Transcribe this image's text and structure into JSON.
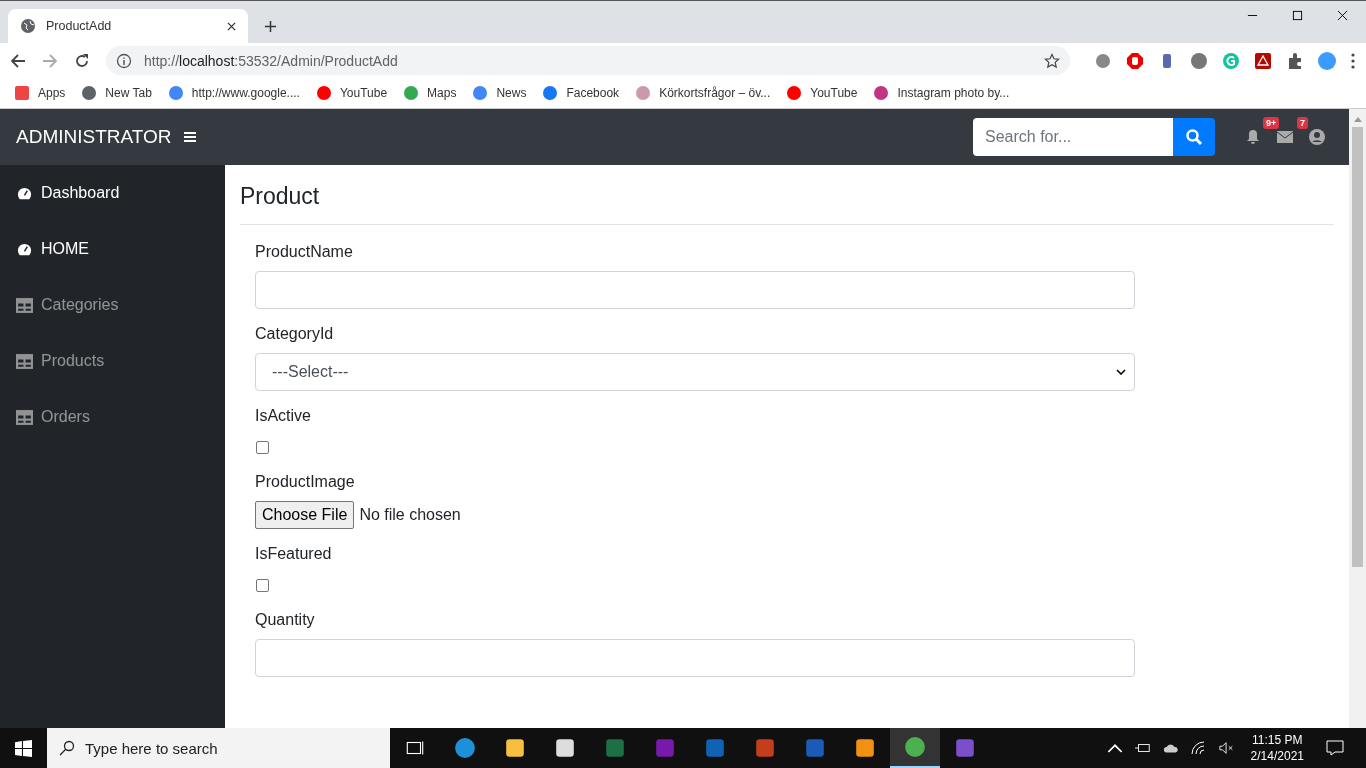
{
  "browser": {
    "tab_title": "ProductAdd",
    "url_host": "localhost",
    "url_prefix": "http://",
    "url_rest": ":53532/Admin/ProductAdd",
    "bookmarks": [
      "Apps",
      "New Tab",
      "http://www.google....",
      "YouTube",
      "Maps",
      "News",
      "Facebook",
      "Körkortsfrågor – öv...",
      "YouTube",
      "Instagram photo by..."
    ]
  },
  "navbar": {
    "brand": "ADMINISTRATOR",
    "search": {
      "placeholder": "Search for..."
    },
    "alerts_badge": "9+",
    "messages_badge": "7"
  },
  "sidebar": {
    "items": [
      {
        "label": "Dashboard",
        "active": true
      },
      {
        "label": "HOME",
        "active": true
      },
      {
        "label": "Categories",
        "active": false
      },
      {
        "label": "Products",
        "active": false
      },
      {
        "label": "Orders",
        "active": false
      }
    ]
  },
  "page": {
    "title": "Product",
    "fields": [
      {
        "kind": "text",
        "label": "ProductName"
      },
      {
        "kind": "select",
        "label": "CategoryId",
        "value": "---Select---"
      },
      {
        "kind": "checkbox",
        "label": "IsActive",
        "checked": false
      },
      {
        "kind": "file",
        "label": "ProductImage",
        "button": "Choose File",
        "status": "No file chosen"
      },
      {
        "kind": "checkbox",
        "label": "IsFeatured",
        "checked": false
      },
      {
        "kind": "text",
        "label": "Quantity"
      }
    ]
  },
  "taskbar": {
    "search_placeholder": "Type here to search",
    "time": "11:15 PM",
    "date": "2/14/2021"
  }
}
